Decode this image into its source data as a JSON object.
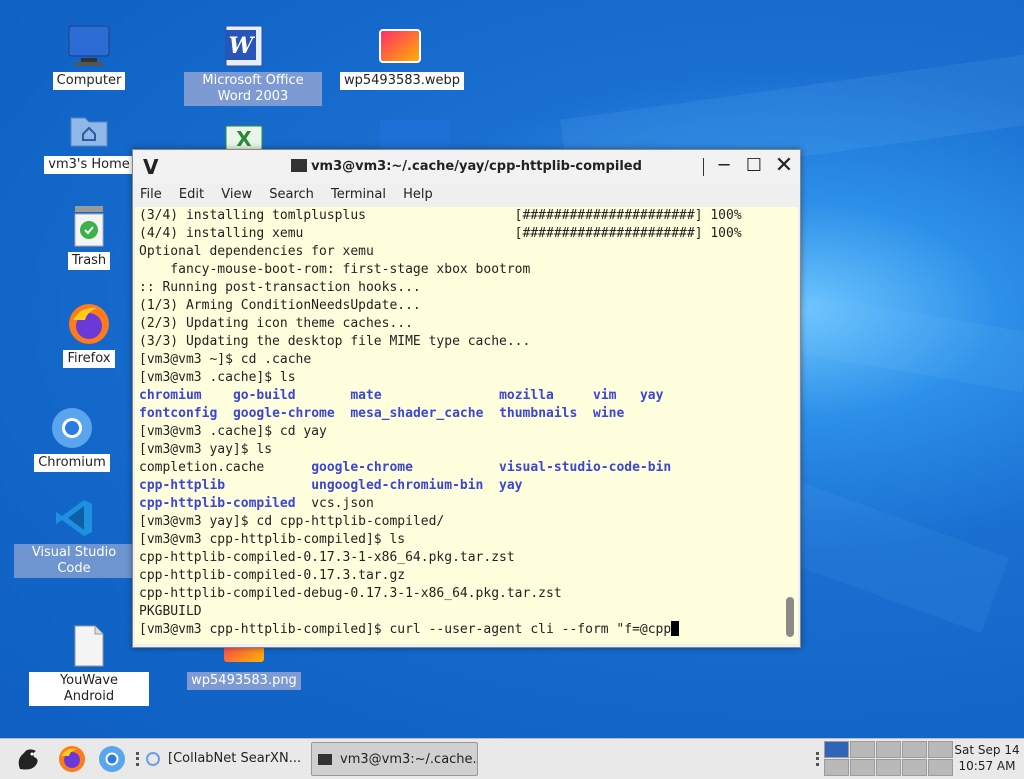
{
  "desktop": {
    "icons": [
      {
        "label": "Computer",
        "icon": "computer-icon"
      },
      {
        "label": "Microsoft Office Word 2003",
        "icon": "word-icon"
      },
      {
        "label": "wp5493583.webp",
        "icon": "image-file-icon"
      },
      {
        "label": "vm3's Home",
        "icon": "home-folder-icon"
      },
      {
        "label": "Trash",
        "icon": "trash-icon"
      },
      {
        "label": "Firefox",
        "icon": "firefox-icon"
      },
      {
        "label": "Chromium",
        "icon": "chromium-icon"
      },
      {
        "label": "Visual Studio Code",
        "icon": "vscode-icon"
      },
      {
        "label": "YouWave Android",
        "icon": "document-icon"
      },
      {
        "label": "wp5493583.png",
        "icon": "image-file-icon"
      }
    ]
  },
  "terminal": {
    "title": "vm3@vm3:~/.cache/yay/cpp-httplib-compiled",
    "menu": [
      "File",
      "Edit",
      "View",
      "Search",
      "Terminal",
      "Help"
    ],
    "lines": [
      "(3/4) installing tomlplusplus                   [######################] 100%",
      "(4/4) installing xemu                           [######################] 100%",
      "Optional dependencies for xemu",
      "    fancy-mouse-boot-rom: first-stage xbox bootrom",
      ":: Running post-transaction hooks...",
      "(1/3) Arming ConditionNeedsUpdate...",
      "(2/3) Updating icon theme caches...",
      "(3/3) Updating the desktop file MIME type cache...",
      "[vm3@vm3 ~]$ cd .cache",
      "[vm3@vm3 .cache]$ ls"
    ],
    "ls_cache": {
      "row1": [
        "chromium",
        "go-build",
        "mate",
        "mozilla",
        "vim",
        "yay"
      ],
      "row2": [
        "fontconfig",
        "google-chrome",
        "mesa_shader_cache",
        "thumbnails",
        "wine"
      ]
    },
    "cmd_cd_yay": "[vm3@vm3 .cache]$ cd yay",
    "cmd_ls_yay": "[vm3@vm3 yay]$ ls",
    "ls_yay": {
      "row1": [
        "completion.cache",
        "google-chrome",
        "visual-studio-code-bin"
      ],
      "row2": [
        "cpp-httplib",
        "ungoogled-chromium-bin",
        "yay"
      ],
      "row3": [
        "cpp-httplib-compiled",
        "vcs.json"
      ]
    },
    "tail_lines": [
      "[vm3@vm3 yay]$ cd cpp-httplib-compiled/",
      "[vm3@vm3 cpp-httplib-compiled]$ ls",
      "cpp-httplib-compiled-0.17.3-1-x86_64.pkg.tar.zst",
      "cpp-httplib-compiled-0.17.3.tar.gz",
      "cpp-httplib-compiled-debug-0.17.3-1-x86_64.pkg.tar.zst",
      "PKGBUILD"
    ],
    "prompt_line": "[vm3@vm3 cpp-httplib-compiled]$ curl --user-agent cli --form \"f=@cpp"
  },
  "taskbar": {
    "tasks": [
      {
        "label": "[CollabNet SearXN...",
        "icon": "browser-icon"
      },
      {
        "label": "vm3@vm3:~/.cache...",
        "icon": "terminal-icon"
      }
    ],
    "clock": {
      "date": "Sat Sep 14",
      "time": "10:57 AM"
    }
  },
  "colors": {
    "terminal_bg": "#ffffdd",
    "dir_blue": "#3b45d6",
    "desktop_blue": "#1f7ad6"
  }
}
